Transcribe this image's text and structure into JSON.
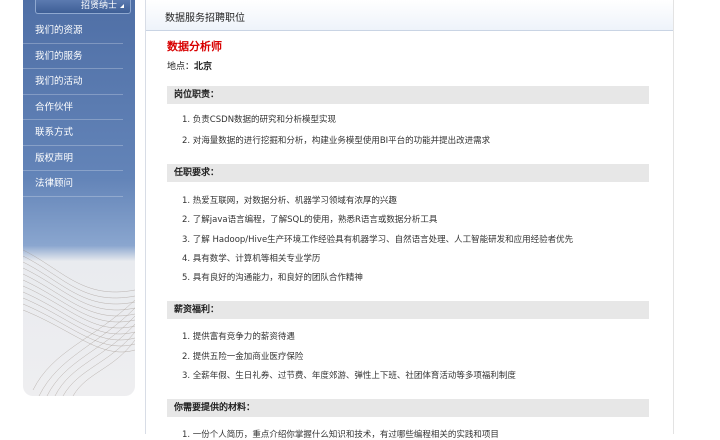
{
  "sidebar": {
    "top_label": "招贤纳士",
    "items": [
      {
        "label": "我们的资源"
      },
      {
        "label": "我们的服务"
      },
      {
        "label": "我们的活动"
      },
      {
        "label": "合作伙伴"
      },
      {
        "label": "联系方式"
      },
      {
        "label": "版权声明"
      },
      {
        "label": "法律顾问"
      }
    ]
  },
  "main": {
    "header_title": "数据服务招聘职位",
    "job_title": "数据分析师",
    "location_label": "地点：",
    "location_value": "北京",
    "sections": [
      {
        "title": "岗位职责：",
        "items": [
          "1. 负责CSDN数据的研究和分析模型实现",
          "2. 对海量数据的进行挖掘和分析，构建业务模型使用BI平台的功能并提出改进需求"
        ]
      },
      {
        "title": "任职要求：",
        "items": [
          "1. 热爱互联网，对数据分析、机器学习领域有浓厚的兴趣",
          "2. 了解java语言编程，了解SQL的使用，熟悉R语言或数据分析工具",
          "3. 了解 Hadoop/Hive生产环境工作经验具有机器学习、自然语言处理、人工智能研发和应用经验者优先",
          "4. 具有数学、计算机等相关专业学历",
          "5. 具有良好的沟通能力，和良好的团队合作精神"
        ]
      },
      {
        "title": "薪资福利：",
        "items": [
          "1. 提供富有竞争力的薪资待遇",
          "2. 提供五险一金加商业医疗保险",
          "3. 全薪年假、生日礼券、过节费、年度郊游、弹性上下班、社团体育活动等多项福利制度"
        ]
      },
      {
        "title": "你需要提供的材料：",
        "items": [
          "1. 一份个人简历，重点介绍你掌握什么知识和技术，有过哪些编程相关的实践和项目"
        ]
      }
    ]
  }
}
